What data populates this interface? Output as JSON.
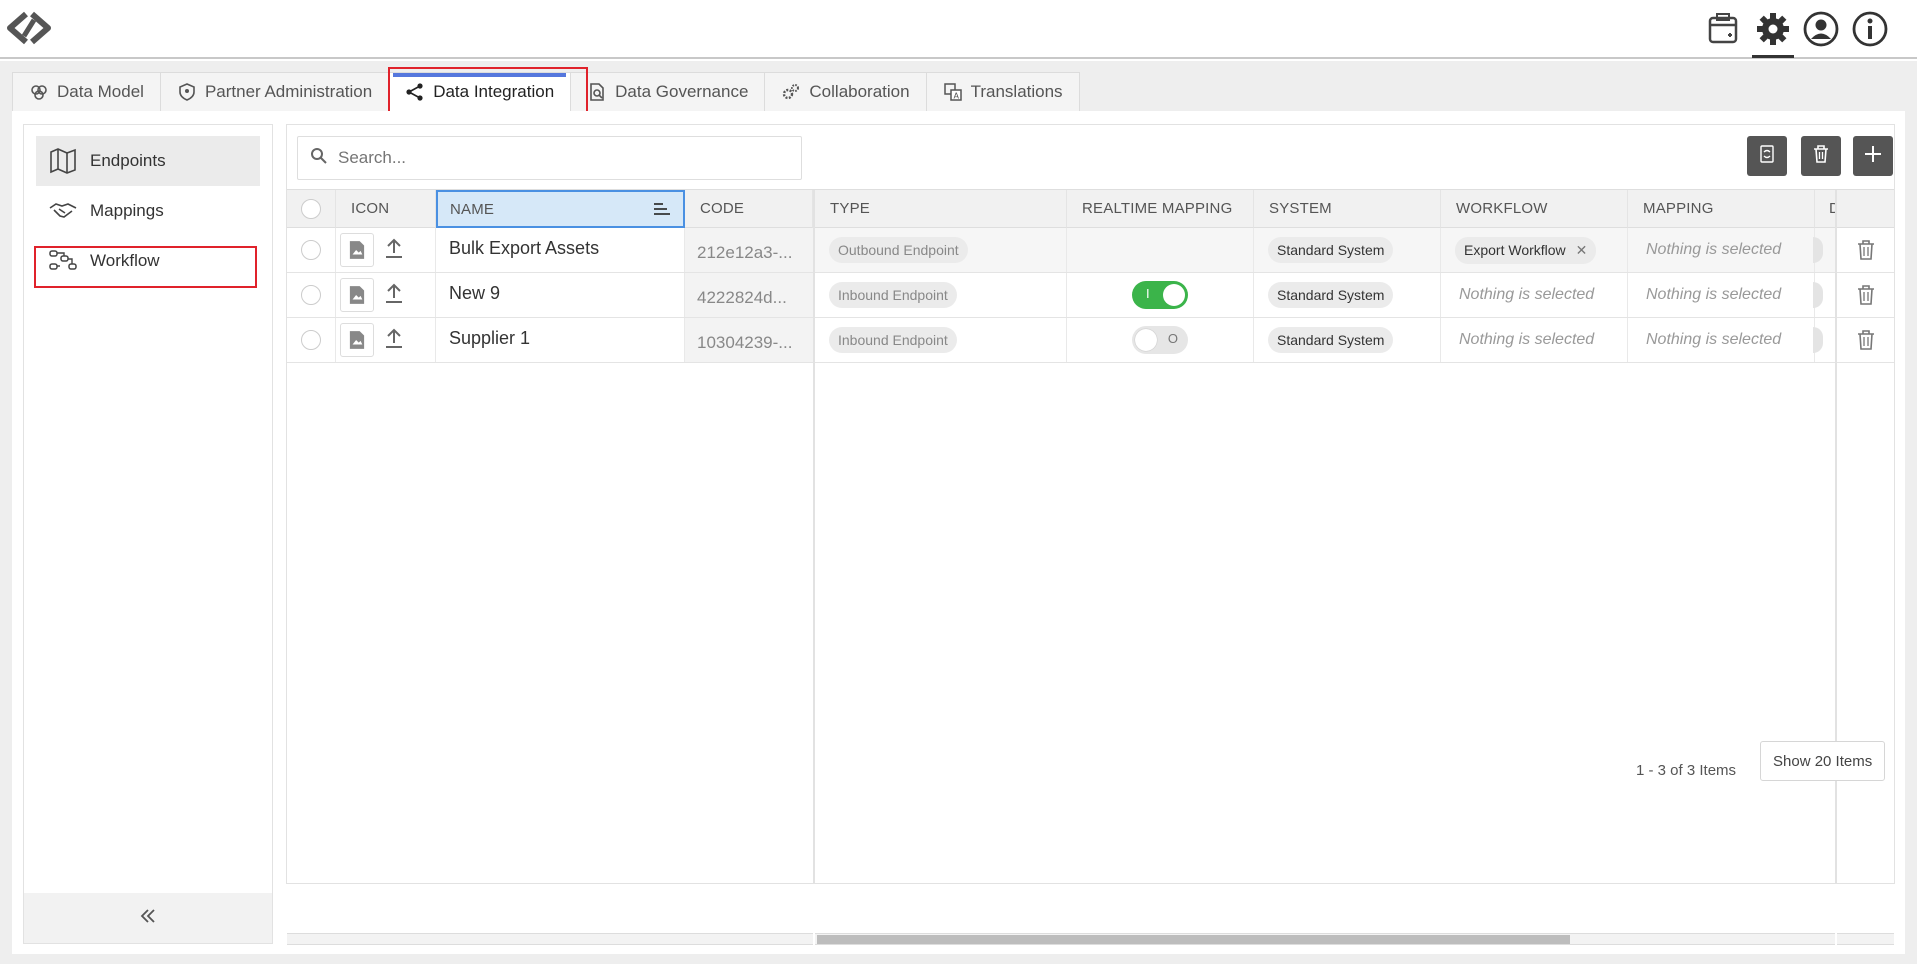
{
  "tabs": [
    {
      "label": "Data Model",
      "icon": "data-model-icon"
    },
    {
      "label": "Partner Administration",
      "icon": "shield-icon"
    },
    {
      "label": "Data Integration",
      "icon": "share-nodes-icon",
      "active": true
    },
    {
      "label": "Data Governance",
      "icon": "document-search-icon"
    },
    {
      "label": "Collaboration",
      "icon": "gears-icon"
    },
    {
      "label": "Translations",
      "icon": "translate-icon"
    }
  ],
  "sidebar": {
    "items": [
      {
        "label": "Endpoints",
        "icon": "map-icon",
        "active": true
      },
      {
        "label": "Mappings",
        "icon": "handshake-icon"
      },
      {
        "label": "Workflow",
        "icon": "workflow-icon"
      }
    ]
  },
  "search": {
    "placeholder": "Search..."
  },
  "columns": {
    "icon": "ICON",
    "name": "NAME",
    "code": "CODE",
    "type": "TYPE",
    "realtime": "REALTIME MAPPING",
    "system": "SYSTEM",
    "workflow": "WORKFLOW",
    "mapping": "MAPPING",
    "partial": "D"
  },
  "rows": [
    {
      "name": "Bulk Export Assets",
      "code": "212e12a3-...",
      "type": "Outbound Endpoint",
      "realtime": null,
      "system": "Standard System",
      "workflow": "Export Workflow",
      "workflow_removable": true,
      "mapping": "Nothing is selected"
    },
    {
      "name": "New 9",
      "code": "4222824d...",
      "type": "Inbound Endpoint",
      "realtime": "I",
      "system": "Standard System",
      "workflow": "Nothing is selected",
      "workflow_removable": false,
      "mapping": "Nothing is selected"
    },
    {
      "name": "Supplier 1",
      "code": "10304239-...",
      "type": "Inbound Endpoint",
      "realtime": "O",
      "system": "Standard System",
      "workflow": "Nothing is selected",
      "workflow_removable": false,
      "mapping": "Nothing is selected"
    }
  ],
  "footer": {
    "count": "1 - 3 of 3 Items",
    "show_button": "Show 20 Items"
  },
  "colors": {
    "accent": "#5577dd",
    "highlight": "#e0222b",
    "toggle_on": "#3bb44a",
    "header_bg": "#f1f1f1"
  }
}
